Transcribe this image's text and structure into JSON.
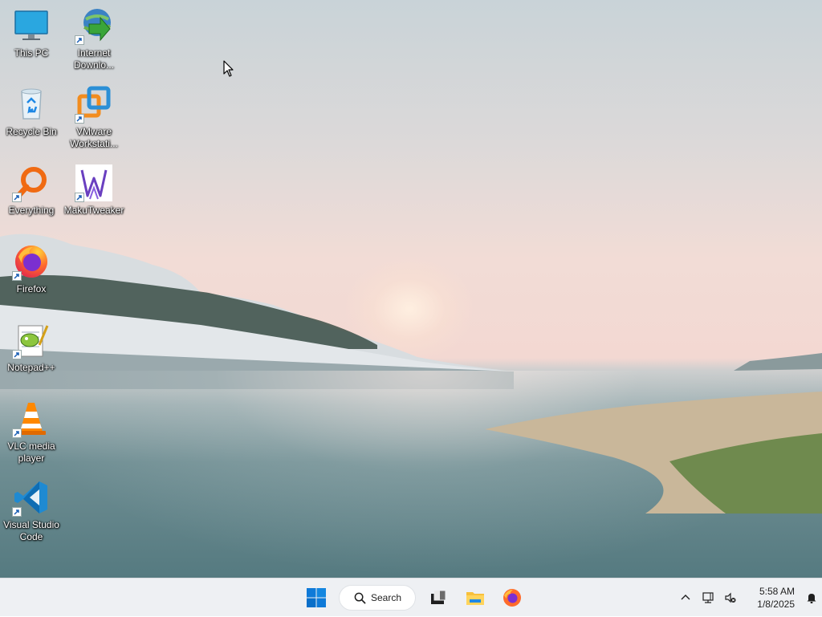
{
  "desktop": {
    "icons": [
      {
        "label": "This PC",
        "icon": "monitor-icon",
        "shortcut": false
      },
      {
        "label": "Internet Downlo...",
        "icon": "idm-icon",
        "shortcut": true
      },
      {
        "label": "Recycle Bin",
        "icon": "recycle-bin-icon",
        "shortcut": false
      },
      {
        "label": "VMware Workstati...",
        "icon": "vmware-icon",
        "shortcut": true
      },
      {
        "label": "Everything",
        "icon": "everything-search-icon",
        "shortcut": true
      },
      {
        "label": "MakuTweaker",
        "icon": "makutweaker-icon",
        "shortcut": true
      },
      {
        "label": "Firefox",
        "icon": "firefox-icon",
        "shortcut": true
      },
      {
        "label": "Notepad++",
        "icon": "notepadpp-icon",
        "shortcut": true
      },
      {
        "label": "VLC media player",
        "icon": "vlc-cone-icon",
        "shortcut": true
      },
      {
        "label": "Visual Studio Code",
        "icon": "vscode-icon",
        "shortcut": true
      }
    ]
  },
  "taskbar": {
    "search_label": "Search",
    "pinned": [
      {
        "icon": "windows-start-icon"
      },
      {
        "icon": "search-icon"
      },
      {
        "icon": "task-view-icon"
      },
      {
        "icon": "file-explorer-icon"
      },
      {
        "icon": "firefox-icon"
      }
    ],
    "tray": {
      "chevron": "chevron-up-icon",
      "network": "network-icon",
      "volume": "volume-muted-icon",
      "time": "5:58 AM",
      "date": "1/8/2025",
      "notifications": "bell-icon"
    }
  },
  "colors": {
    "taskbar_bg": "#eef0f3",
    "windows_blue": "#0078d4"
  }
}
